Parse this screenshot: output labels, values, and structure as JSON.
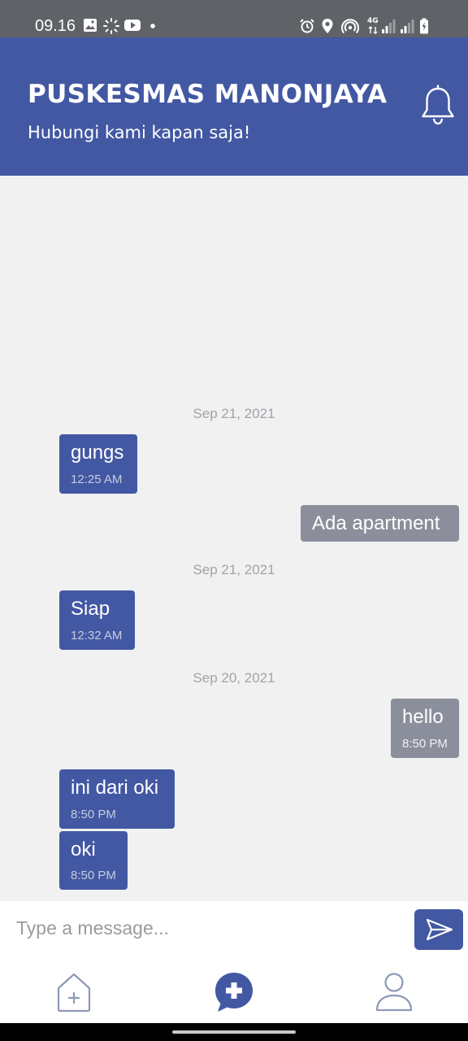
{
  "status_bar": {
    "time": "09.16",
    "left_icons": [
      "gallery-icon",
      "loading-icon",
      "youtube-icon",
      "dot-icon"
    ],
    "right_icons": [
      "alarm-icon",
      "location-icon",
      "hotspot-icon",
      "network-4g-icon",
      "signal-icon",
      "signal-icon",
      "battery-charging-icon"
    ],
    "network_label": "4G"
  },
  "header": {
    "title": "PUSKESMAS MANONJAYA",
    "subtitle": "Hubungi kami kapan saja!",
    "icon": "bell-icon",
    "background": "#4358a3"
  },
  "chat": {
    "date_separators": [
      "Sep 21, 2021",
      "Sep 21, 2021",
      "Sep 20, 2021"
    ],
    "messages": [
      {
        "side": "incoming",
        "text": "gungs",
        "time": "12:25 AM"
      },
      {
        "side": "outgoing",
        "text": "Ada apartment"
      },
      {
        "side": "incoming",
        "text": "Siap",
        "time": "12:32 AM"
      },
      {
        "side": "outgoing",
        "text": "hello",
        "time": "8:50 PM"
      },
      {
        "side": "incoming",
        "text": "ini dari oki",
        "time": "8:50 PM"
      },
      {
        "side": "incoming",
        "text": "oki",
        "time": "8:50 PM"
      }
    ],
    "colors": {
      "incoming": "#4358a3",
      "outgoing": "#8a8f9b"
    }
  },
  "composer": {
    "placeholder": "Type a message...",
    "value": "",
    "send_icon": "send-icon"
  },
  "bottom_nav": {
    "items": [
      {
        "icon": "home-add-icon",
        "active": false
      },
      {
        "icon": "chat-medical-icon",
        "active": true
      },
      {
        "icon": "profile-icon",
        "active": false
      }
    ]
  }
}
